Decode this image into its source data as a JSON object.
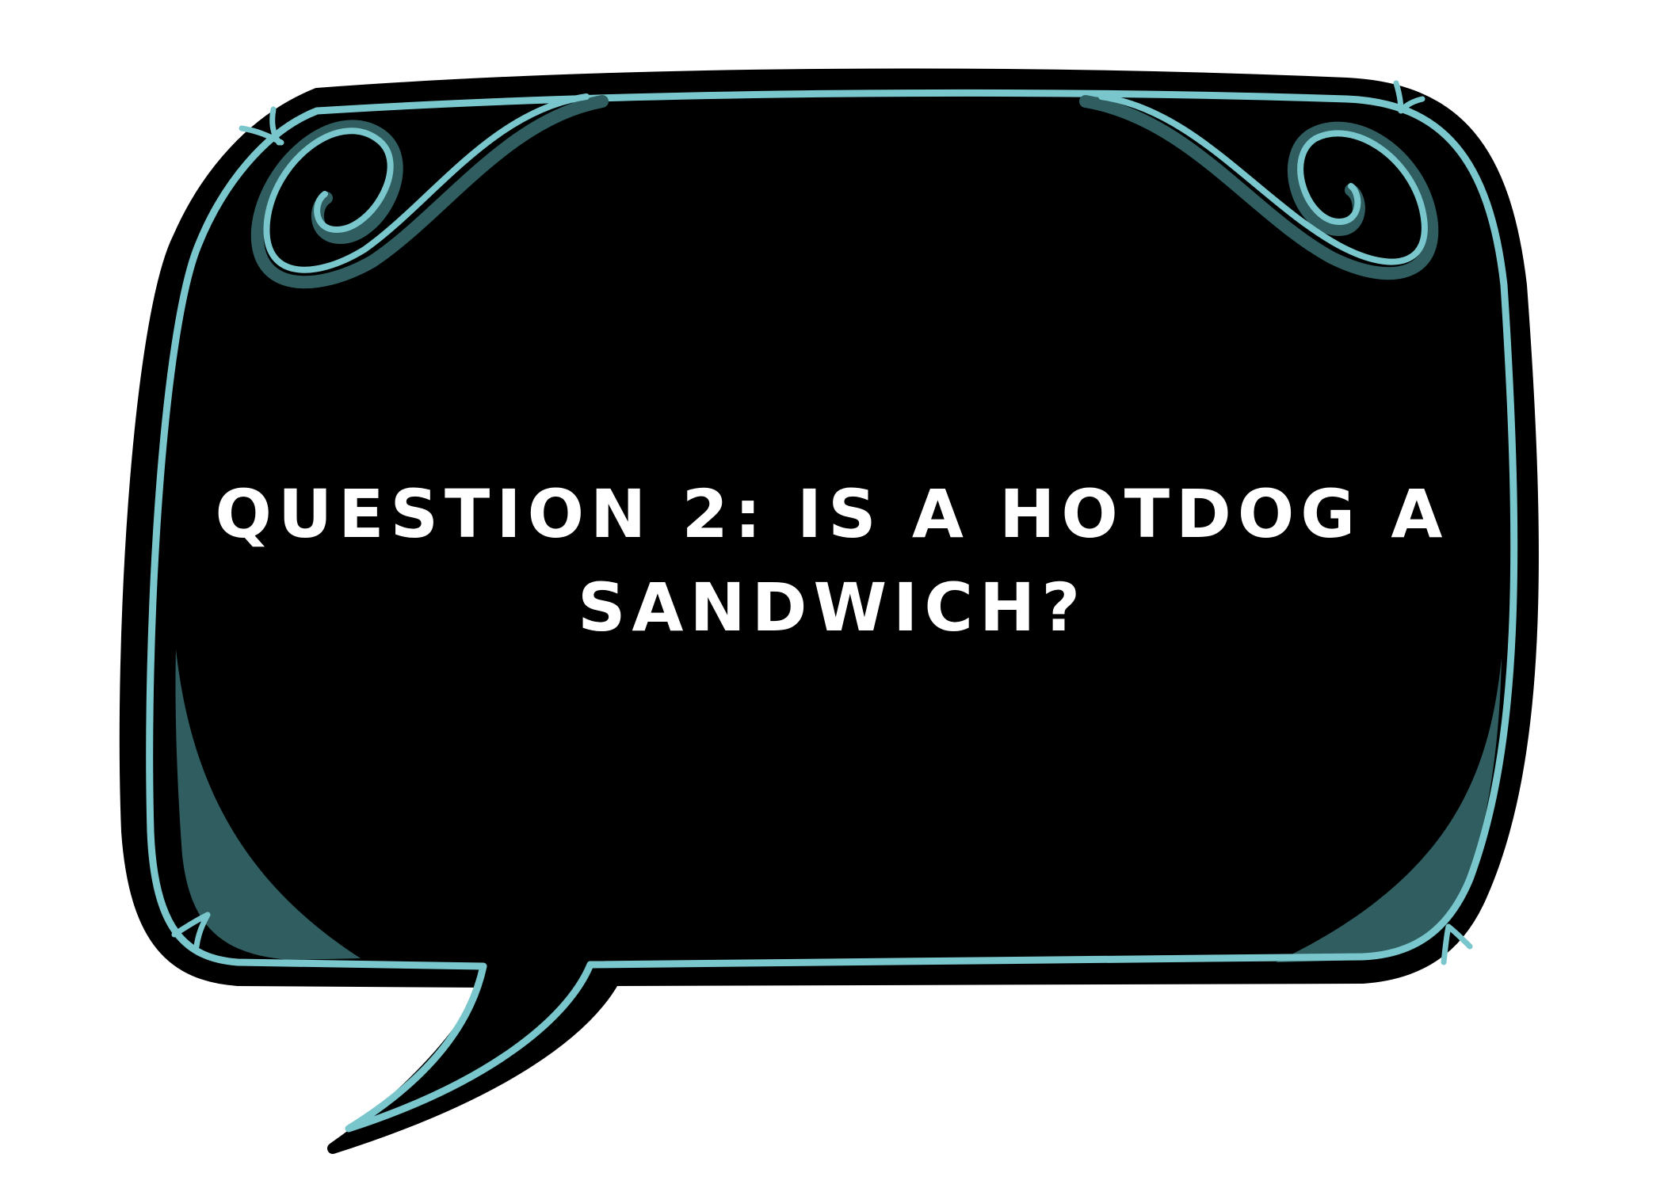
{
  "speech_bubble": {
    "question": "QUESTION 2: IS A HOTDOG A SANDWICH?"
  },
  "colors": {
    "bubble_fill": "#000000",
    "outline": "#79c7cc",
    "shadow_teal": "#2f5d60",
    "text": "#ffffff",
    "background": "#ffffff"
  },
  "icons": {
    "corner_decor": "swirl-flourish"
  }
}
